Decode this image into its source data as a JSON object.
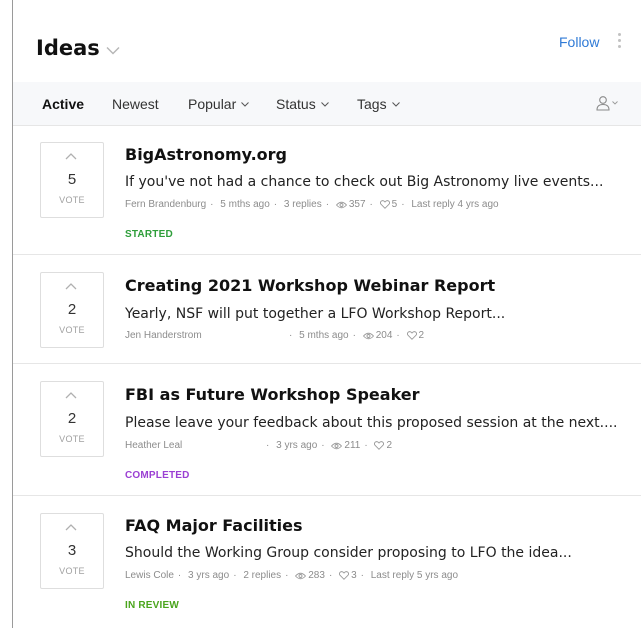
{
  "header": {
    "title": "Ideas",
    "follow_label": "Follow"
  },
  "tabs": [
    {
      "label": "Active"
    },
    {
      "label": "Newest"
    },
    {
      "label": "Popular"
    },
    {
      "label": "Status"
    },
    {
      "label": "Tags"
    }
  ],
  "ideas": [
    {
      "votes": "5",
      "vote_label": "VOTE",
      "title": "BigAstronomy.org",
      "excerpt": "If you've not had a chance to check out Big Astronomy live events...",
      "author": "Fern Brandenburg",
      "age": "5 mths ago",
      "replies": "3 replies",
      "views": "357",
      "likes": "5",
      "last_reply": "Last reply 4 yrs ago",
      "status": "STARTED",
      "status_color": "#2e9e3a"
    },
    {
      "votes": "2",
      "vote_label": "VOTE",
      "title": "Creating 2021 Workshop Webinar Report",
      "excerpt": "Yearly, NSF will put together a LFO Workshop Report...",
      "author": "Jen Handerstrom",
      "age": "5 mths ago",
      "views": "204",
      "likes": "2"
    },
    {
      "votes": "2",
      "vote_label": "VOTE",
      "title": "FBI as Future Workshop Speaker",
      "excerpt": "Please leave your feedback about this proposed session at the next....",
      "author": "Heather Leal",
      "age": "3 yrs ago",
      "views": "211",
      "likes": "2",
      "status": "COMPLETED",
      "status_color": "#9b3fd3"
    },
    {
      "votes": "3",
      "vote_label": "VOTE",
      "title": "FAQ Major Facilities",
      "excerpt": "Should the Working Group consider proposing to LFO the idea...",
      "author": "Lewis Cole",
      "age": "3 yrs ago",
      "replies": "2 replies",
      "views": "283",
      "likes": "3",
      "last_reply": "Last reply 5 yrs ago",
      "status": "IN REVIEW",
      "status_color": "#4aa51c"
    }
  ]
}
